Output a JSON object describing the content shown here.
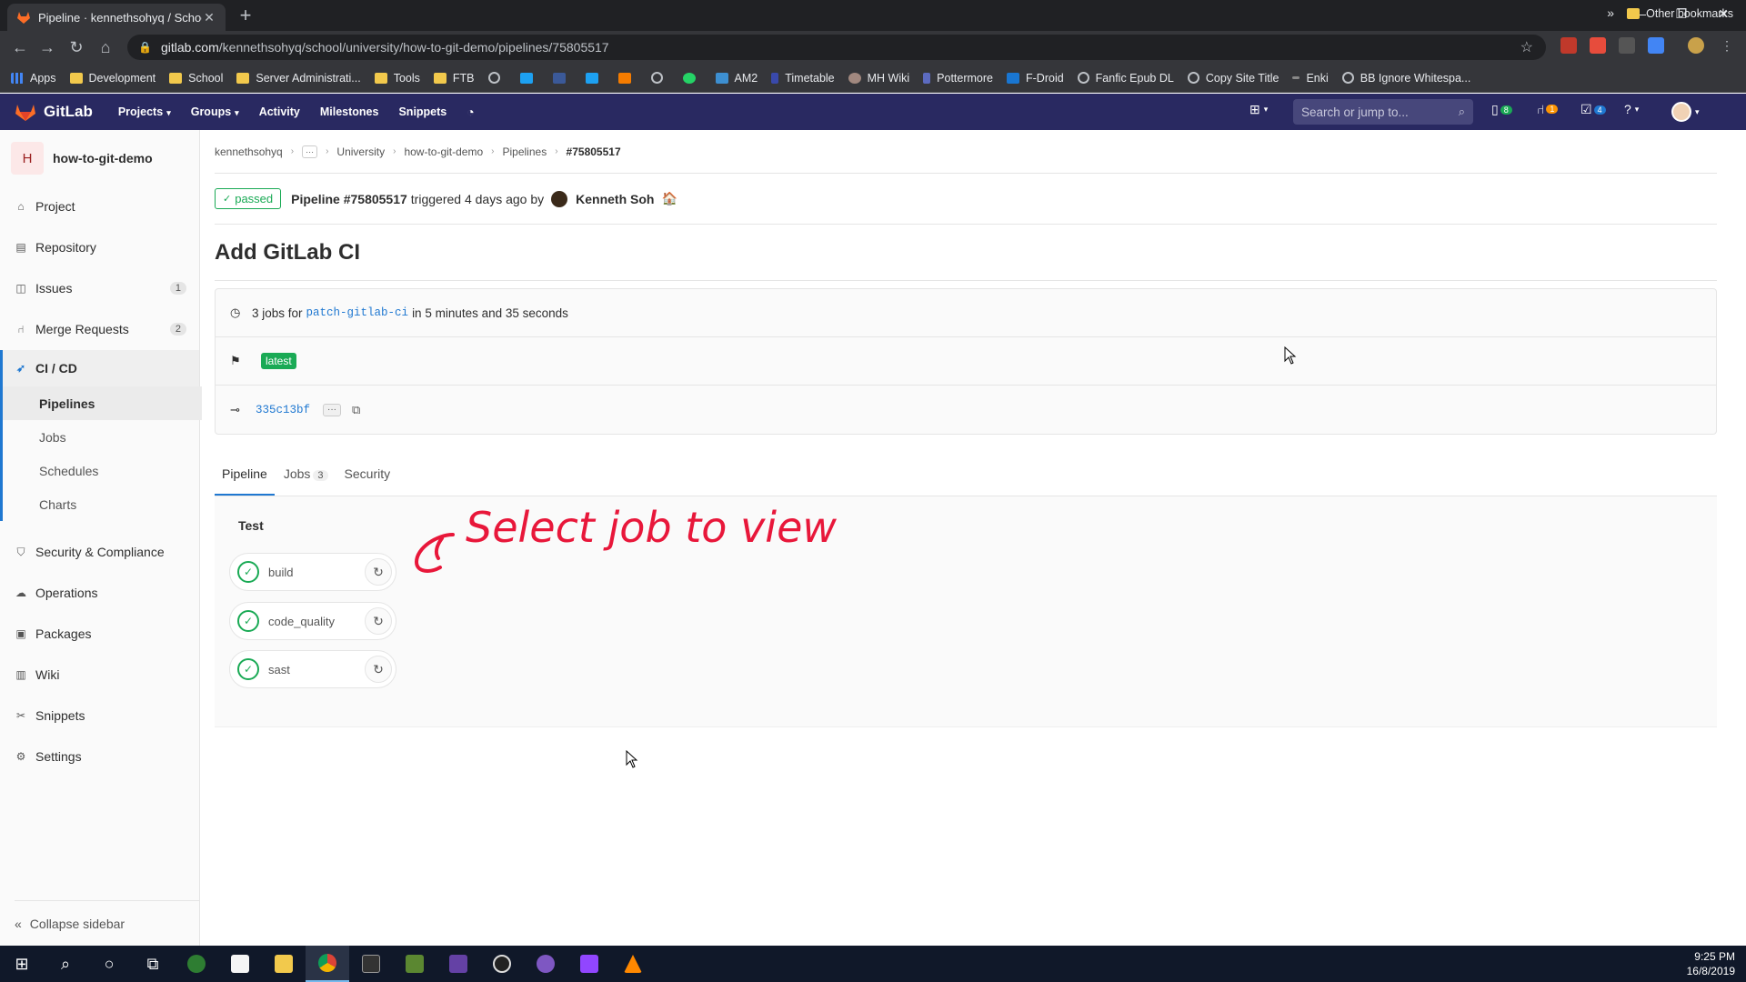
{
  "browser": {
    "tab_title": "Pipeline · kennethsohyq / School",
    "tab_close": "✕",
    "new_tab": "+",
    "url_host": "gitlab.com",
    "url_path": "/kennethsohyq/school/university/how-to-git-demo/pipelines/75805517",
    "bookmarks": [
      "Apps",
      "Development",
      "School",
      "Server Administrati...",
      "Tools",
      "FTB",
      "AM2",
      "Timetable",
      "MH Wiki",
      "Pottermore",
      "F-Droid",
      "Fanfic Epub DL",
      "Copy Site Title",
      "Enki",
      "BB Ignore Whitespa..."
    ],
    "other_bookmarks": "Other bookmarks",
    "more": "»"
  },
  "gitlab": {
    "logo": "GitLab",
    "nav": [
      "Projects",
      "Groups",
      "Activity",
      "Milestones",
      "Snippets"
    ],
    "search_placeholder": "Search or jump to...",
    "counts": {
      "todos": "8",
      "mrs": "1",
      "issues": "4"
    }
  },
  "sidebar": {
    "project_initial": "H",
    "project_name": "how-to-git-demo",
    "items": [
      {
        "label": "Project",
        "icon": "home-icon"
      },
      {
        "label": "Repository",
        "icon": "book-icon"
      },
      {
        "label": "Issues",
        "icon": "issues-icon",
        "badge": "1"
      },
      {
        "label": "Merge Requests",
        "icon": "merge-icon",
        "badge": "2"
      },
      {
        "label": "CI / CD",
        "icon": "rocket-icon"
      },
      {
        "label": "Security & Compliance",
        "icon": "shield-icon"
      },
      {
        "label": "Operations",
        "icon": "cloud-icon"
      },
      {
        "label": "Packages",
        "icon": "package-icon"
      },
      {
        "label": "Wiki",
        "icon": "wiki-icon"
      },
      {
        "label": "Snippets",
        "icon": "scissors-icon"
      },
      {
        "label": "Settings",
        "icon": "gear-icon"
      }
    ],
    "cicd_sub": [
      "Pipelines",
      "Jobs",
      "Schedules",
      "Charts"
    ],
    "collapse": "Collapse sidebar"
  },
  "breadcrumb": [
    "kennethsohyq",
    "University",
    "how-to-git-demo",
    "Pipelines",
    "#75805517"
  ],
  "pipeline": {
    "status": "passed",
    "id_text": "Pipeline #75805517",
    "triggered": "triggered 4 days ago by",
    "user": "Kenneth Soh",
    "title": "Add GitLab CI",
    "jobs_text": "3 jobs for",
    "branch": "patch-gitlab-ci",
    "duration": "in 5 minutes and 35 seconds",
    "tag": "latest",
    "commit": "335c13bf"
  },
  "tabs": [
    {
      "label": "Pipeline"
    },
    {
      "label": "Jobs",
      "count": "3"
    },
    {
      "label": "Security"
    }
  ],
  "stage": {
    "name": "Test",
    "jobs": [
      "build",
      "code_quality",
      "sast"
    ]
  },
  "annotation": "Select job to view",
  "taskbar": {
    "time": "9:25 PM",
    "date": "16/8/2019"
  },
  "colors": {
    "header": "#292961",
    "success": "#1aaa55",
    "link": "#1f78d1",
    "annotation": "#e8173a"
  }
}
